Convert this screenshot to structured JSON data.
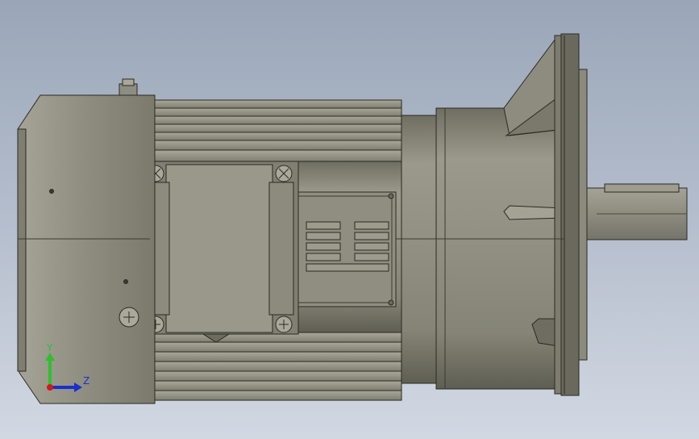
{
  "viewport": {
    "background_top": "#9aa6b8",
    "background_bottom": "#d2d8e2"
  },
  "model": {
    "body_color": "#8f8e80",
    "shade_color": "#6d6c60",
    "highlight_color": "#b4b3a6",
    "edge_color": "#2a2a22"
  },
  "axis_triad": {
    "y_label": "Y",
    "z_label": "Z",
    "y_color": "#2fbf2f",
    "z_color": "#1a2fd0",
    "x_color": "#d01a1a"
  },
  "icons": [
    "screw-icon",
    "axis-triad-icon"
  ]
}
